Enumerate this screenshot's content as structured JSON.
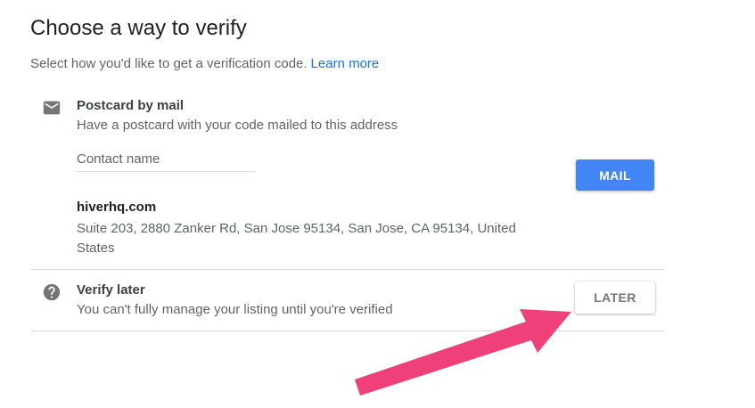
{
  "page": {
    "title": "Choose a way to verify",
    "subtitle": "Select how you'd like to get a verification code.",
    "learn_more": "Learn more"
  },
  "options": {
    "postcard": {
      "icon": "mail-icon",
      "title": "Postcard by mail",
      "description": "Have a postcard with your code mailed to this address",
      "contact_placeholder": "Contact name",
      "button_label": "MAIL",
      "business_name": "hiverhq.com",
      "address": "Suite 203, 2880 Zanker Rd, San Jose 95134, San Jose, CA 95134, United States"
    },
    "later": {
      "icon": "help-circle-icon",
      "title": "Verify later",
      "description": "You can't fully manage your listing until you're verified",
      "button_label": "LATER"
    }
  },
  "colors": {
    "primary_button": "#4285f4",
    "link": "#1a73e8",
    "annotation_arrow": "#f0407a"
  }
}
